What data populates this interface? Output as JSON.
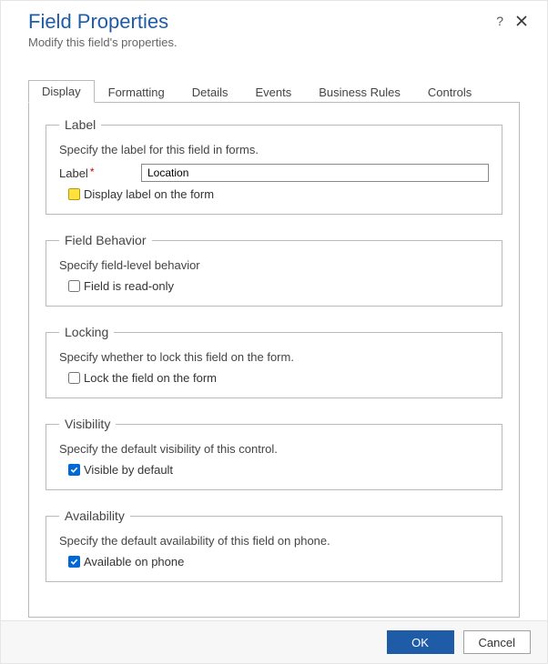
{
  "header": {
    "title": "Field Properties",
    "subtitle": "Modify this field's properties."
  },
  "tabs": [
    {
      "label": "Display"
    },
    {
      "label": "Formatting"
    },
    {
      "label": "Details"
    },
    {
      "label": "Events"
    },
    {
      "label": "Business Rules"
    },
    {
      "label": "Controls"
    }
  ],
  "label_section": {
    "legend": "Label",
    "desc": "Specify the label for this field in forms.",
    "field_label": "Label",
    "value": "Location",
    "display_on_form_label": "Display label on the form",
    "display_on_form_checked": true
  },
  "behavior_section": {
    "legend": "Field Behavior",
    "desc": "Specify field-level behavior",
    "readonly_label": "Field is read-only",
    "readonly_checked": false
  },
  "locking_section": {
    "legend": "Locking",
    "desc": "Specify whether to lock this field on the form.",
    "lock_label": "Lock the field on the form",
    "lock_checked": false
  },
  "visibility_section": {
    "legend": "Visibility",
    "desc": "Specify the default visibility of this control.",
    "visible_label": "Visible by default",
    "visible_checked": true
  },
  "availability_section": {
    "legend": "Availability",
    "desc": "Specify the default availability of this field on phone.",
    "available_label": "Available on phone",
    "available_checked": true
  },
  "footer": {
    "ok": "OK",
    "cancel": "Cancel"
  }
}
